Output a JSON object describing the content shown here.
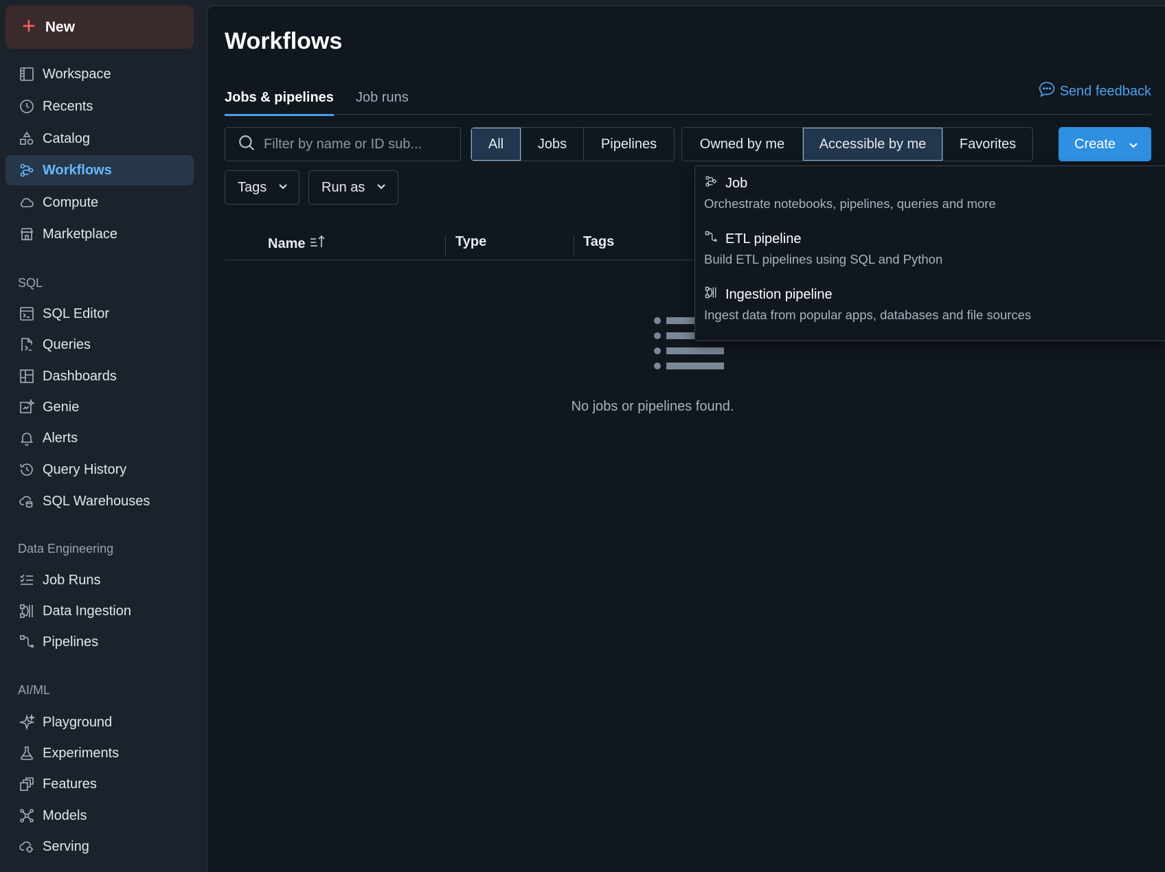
{
  "sidebar": {
    "new_label": "New",
    "items": [
      {
        "label": "Workspace",
        "icon": "workspace-icon"
      },
      {
        "label": "Recents",
        "icon": "clock-icon"
      },
      {
        "label": "Catalog",
        "icon": "catalog-icon"
      },
      {
        "label": "Workflows",
        "icon": "workflows-icon",
        "active": true
      },
      {
        "label": "Compute",
        "icon": "cloud-icon"
      },
      {
        "label": "Marketplace",
        "icon": "store-icon"
      }
    ],
    "sql_label": "SQL",
    "sql_items": [
      {
        "label": "SQL Editor",
        "icon": "terminal-icon"
      },
      {
        "label": "Queries",
        "icon": "query-file-icon"
      },
      {
        "label": "Dashboards",
        "icon": "dashboard-icon"
      },
      {
        "label": "Genie",
        "icon": "genie-icon"
      },
      {
        "label": "Alerts",
        "icon": "bell-icon"
      },
      {
        "label": "Query History",
        "icon": "history-icon"
      },
      {
        "label": "SQL Warehouses",
        "icon": "warehouse-icon"
      }
    ],
    "de_label": "Data Engineering",
    "de_items": [
      {
        "label": "Job Runs",
        "icon": "list-check-icon"
      },
      {
        "label": "Data Ingestion",
        "icon": "ingestion-icon"
      },
      {
        "label": "Pipelines",
        "icon": "pipeline-icon"
      }
    ],
    "ml_label": "AI/ML",
    "ml_items": [
      {
        "label": "Playground",
        "icon": "sparkle-icon"
      },
      {
        "label": "Experiments",
        "icon": "flask-icon"
      },
      {
        "label": "Features",
        "icon": "features-icon"
      },
      {
        "label": "Models",
        "icon": "models-icon"
      },
      {
        "label": "Serving",
        "icon": "serving-icon"
      }
    ]
  },
  "main": {
    "title": "Workflows",
    "tabs": [
      {
        "label": "Jobs & pipelines",
        "active": true
      },
      {
        "label": "Job runs"
      }
    ],
    "feedback_label": "Send feedback",
    "search_placeholder": "Filter by name or ID sub...",
    "type_filter": [
      "All",
      "Jobs",
      "Pipelines"
    ],
    "type_filter_selected": "All",
    "owner_filter": [
      "Owned by me",
      "Accessible by me",
      "Favorites"
    ],
    "owner_filter_selected": "Accessible by me",
    "create_label": "Create",
    "tags_label": "Tags",
    "run_as_label": "Run as",
    "columns": [
      "Name",
      "Type",
      "Tags"
    ],
    "empty_text": "No jobs or pipelines found."
  },
  "create_menu": [
    {
      "title": "Job",
      "desc": "Orchestrate notebooks, pipelines, queries and more",
      "icon": "workflows-icon"
    },
    {
      "title": "ETL pipeline",
      "desc": "Build ETL pipelines using SQL and Python",
      "icon": "pipeline-icon"
    },
    {
      "title": "Ingestion pipeline",
      "desc": "Ingest data from popular apps, databases and file sources",
      "icon": "ingestion-icon"
    }
  ],
  "colors": {
    "accent": "#4aa3f0",
    "create_button": "#2f8fe0",
    "new_plus": "#ff5f5f",
    "active_nav_bg": "#26374a"
  }
}
